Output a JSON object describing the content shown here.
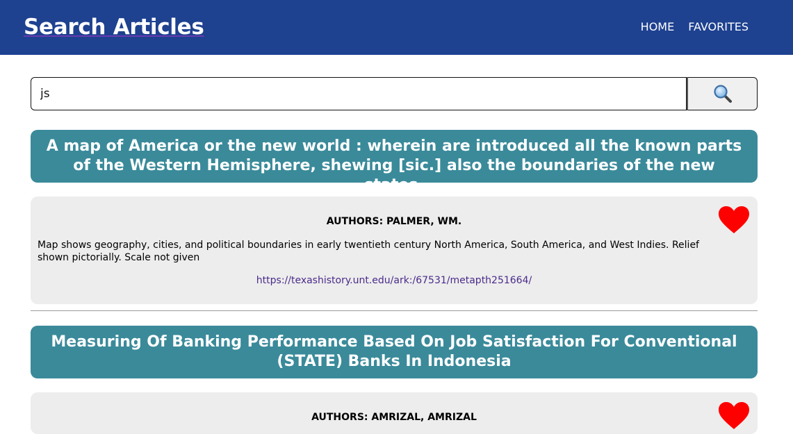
{
  "header": {
    "title": "Search Articles",
    "nav": [
      "HOME",
      "FAVORITES"
    ]
  },
  "search": {
    "value": "js",
    "button_icon": "magnifying-glass-icon"
  },
  "results": [
    {
      "title": "A map of America or the new world : wherein are introduced all the known parts of the Western Hemisphere, shewing [sic.] also the boundaries of the new states.",
      "authors": "AUTHORS: PALMER, WM.",
      "description": "Map shows geography, cities, and political boundaries in early twentieth century North America, South America, and West Indies. Relief shown pictorially. Scale not given",
      "link": "https://texashistory.unt.edu/ark:/67531/metapth251664/",
      "favorite_icon": "heart-icon"
    },
    {
      "title": "Measuring Of Banking Performance Based On Job Satisfaction For Conventional (STATE) Banks In Indonesia",
      "authors": "AUTHORS: AMRIZAL, AMRIZAL",
      "favorite_icon": "heart-icon"
    }
  ],
  "colors": {
    "header_bg": "#1e4190",
    "title_bg": "#3a8a9a",
    "card_bg": "#ededed",
    "heart": "#ff0000",
    "link": "#4a2a8a"
  }
}
